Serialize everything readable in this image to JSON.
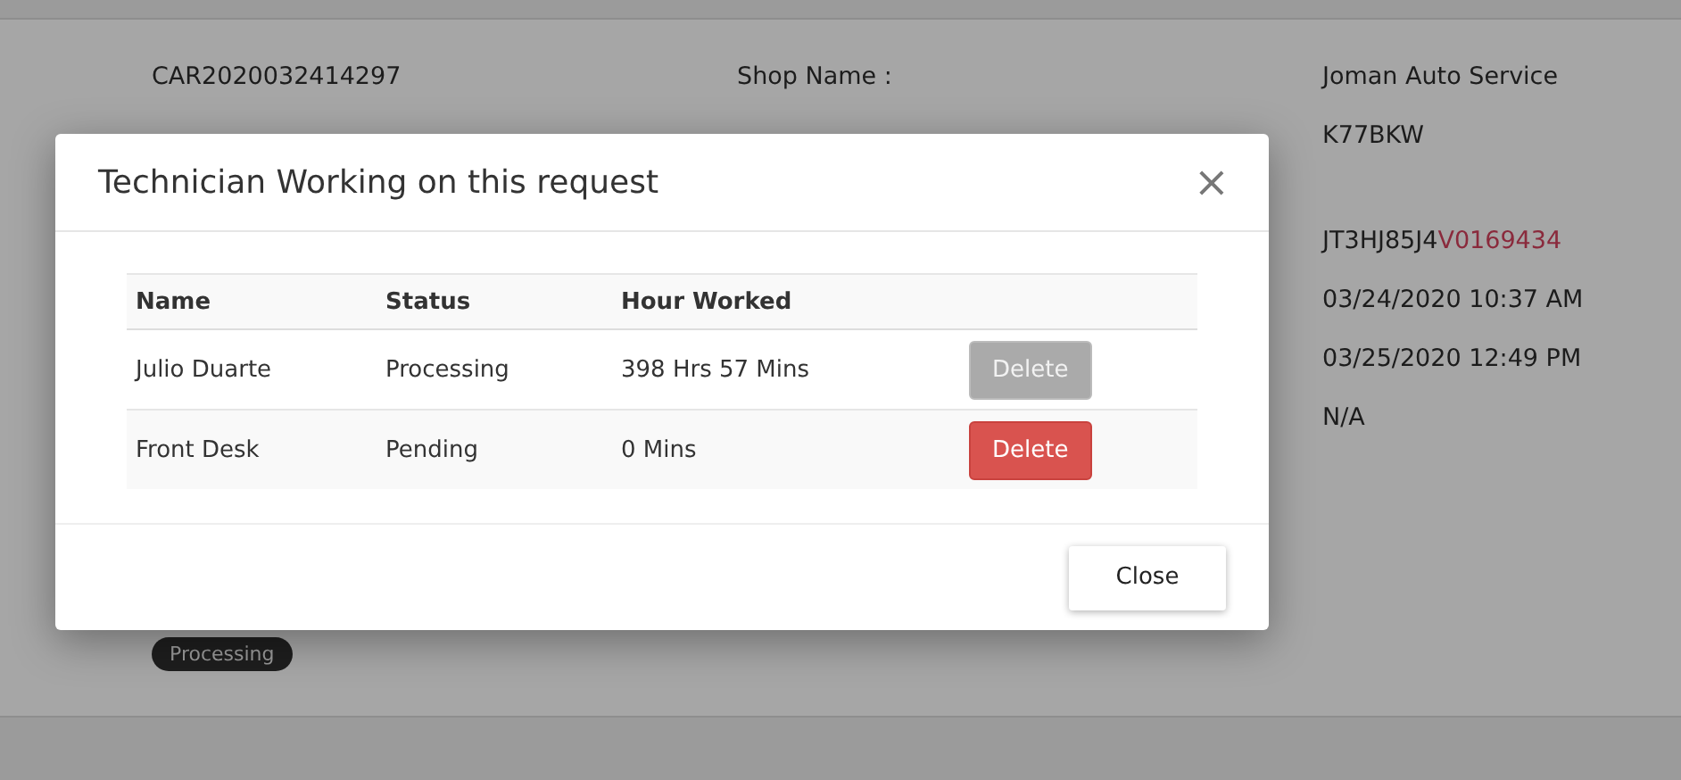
{
  "details": {
    "left": [
      "CAR2020032414297"
    ],
    "middle": [
      "Shop Name :"
    ],
    "right_top": [
      "Joman Auto Service",
      "K77BKW"
    ],
    "vin": {
      "prefix": "JT3HJ85J4",
      "highlight": "V0169434"
    },
    "right_bottom": [
      "03/24/2020 10:37 AM",
      "03/25/2020 12:49 PM",
      "N/A"
    ],
    "status_badge": "Processing"
  },
  "modal": {
    "title": "Technician Working on this request",
    "close_icon": "×",
    "columns": [
      "Name",
      "Status",
      "Hour Worked"
    ],
    "rows": [
      {
        "name": "Julio Duarte",
        "status": "Processing",
        "hours": "398 Hrs 57 Mins",
        "action": "Delete",
        "disabled": true
      },
      {
        "name": "Front Desk",
        "status": "Pending",
        "hours": "0 Mins",
        "action": "Delete",
        "disabled": false
      }
    ],
    "footer_button": "Close"
  }
}
